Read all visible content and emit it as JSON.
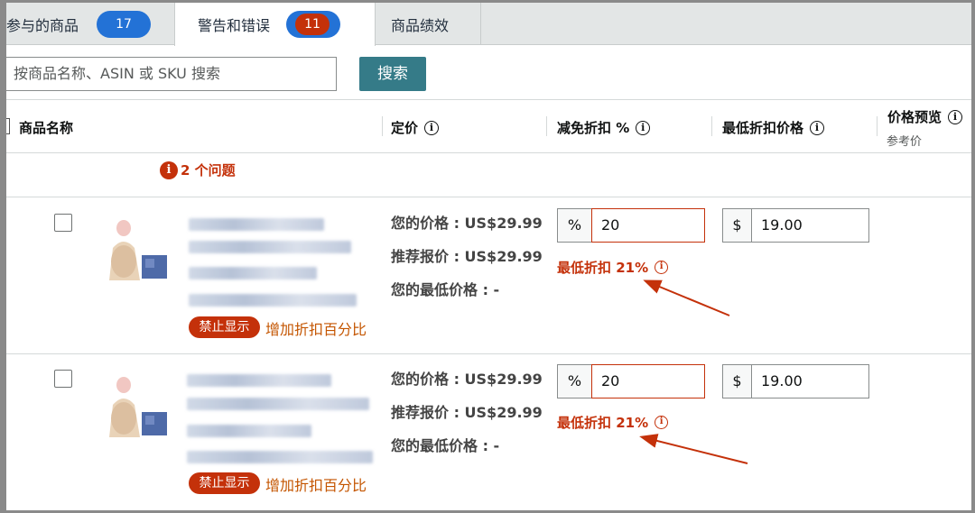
{
  "tabs": [
    {
      "label": "参与的商品",
      "count": "17"
    },
    {
      "label": "警告和错误",
      "count": "11"
    },
    {
      "label": "商品绩效"
    }
  ],
  "search": {
    "placeholder": "按商品名称、ASIN 或 SKU 搜索",
    "button_label": "搜索"
  },
  "table": {
    "headers": {
      "name": "商品名称",
      "price": "定价",
      "discount": "减免折扣 %",
      "min_price": "最低折扣价格",
      "preview": "价格预览",
      "preview_sub": "参考价"
    },
    "issue_text": "2 个问题",
    "rows": [
      {
        "your_price": "您的价格 : US$29.99",
        "rec_price": "推荐报价 : US$29.99",
        "your_min": "您的最低价格 : -",
        "pct_symbol": "%",
        "pct_value": "20",
        "usd_symbol": "$",
        "min_value": "19.00",
        "min_warning": "最低折扣 21%",
        "tag": "禁止显示",
        "add_link": "增加折扣百分比"
      },
      {
        "your_price": "您的价格 : US$29.99",
        "rec_price": "推荐报价 : US$29.99",
        "your_min": "您的最低价格 : -",
        "pct_symbol": "%",
        "pct_value": "20",
        "usd_symbol": "$",
        "min_value": "19.00",
        "min_warning": "最低折扣 21%",
        "tag": "禁止显示",
        "add_link": "增加折扣百分比"
      }
    ]
  },
  "colors": {
    "accent_blue": "#2372d6",
    "error_red": "#c4310a",
    "search_teal": "#357b88",
    "link_orange": "#c45500"
  },
  "icons": [
    "info-icon",
    "error-icon",
    "checkbox-icon",
    "arrow-annotation"
  ]
}
